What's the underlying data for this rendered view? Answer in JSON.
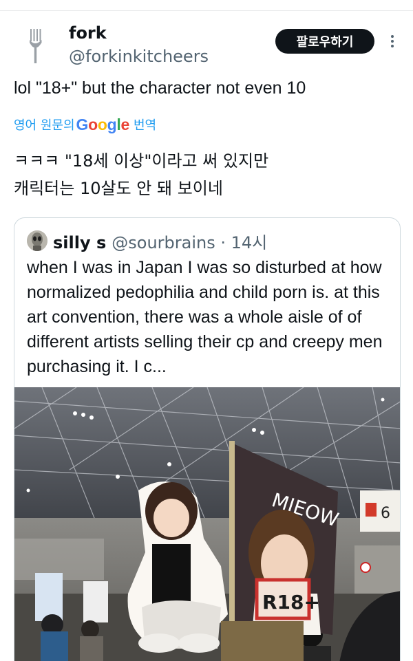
{
  "author": {
    "name": "fork",
    "handle": "@forkinkitcheers",
    "avatar_icon": "fork-icon"
  },
  "follow_button": {
    "label": "팔로우하기"
  },
  "more_icon": "more-vertical-icon",
  "tweet": {
    "text": "lol \"18+\" but the character not even 10"
  },
  "translation": {
    "prefix": "영어 원문의",
    "provider": "Google",
    "suffix": "번역",
    "lines": [
      "ㅋㅋㅋ \"18세 이상\"이라고 써 있지만",
      "캐릭터는 10살도 안 돼 보이네"
    ]
  },
  "quoted": {
    "name": "silly s",
    "handle": "@sourbrains · 14시",
    "text": "when I was in Japan I was so disturbed at how normalized pedophilia and child porn is. at this art convention, there was a whole aisle of of different artists selling their cp and creepy men purchasing it. I c...",
    "image": {
      "banner_text": "MIEOW",
      "rating_badge": "R18+",
      "hall_sign": "6"
    }
  },
  "colors": {
    "text_primary": "#0f1419",
    "text_secondary": "#536471",
    "link_blue": "#1d9bf0",
    "border": "#cfd9de",
    "google_blue": "#4285f4",
    "google_red": "#ea4335",
    "google_yellow": "#fbbc05",
    "google_green": "#34a853"
  }
}
